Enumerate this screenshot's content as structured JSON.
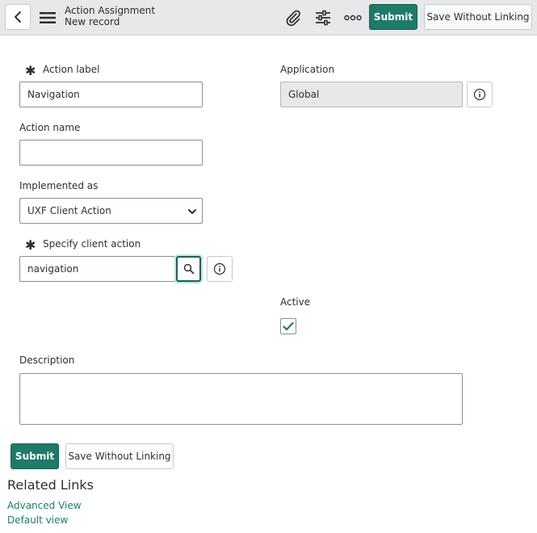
{
  "header": {
    "title": "Action Assignment",
    "subtitle": "New record",
    "submit_label": "Submit",
    "save_without_linking_label": "Save Without Linking"
  },
  "form": {
    "action_label": {
      "label": "Action label",
      "value": "Navigation",
      "required": true
    },
    "application": {
      "label": "Application",
      "value": "Global"
    },
    "action_name": {
      "label": "Action name",
      "value": ""
    },
    "implemented_as": {
      "label": "Implemented as",
      "selected": "UXF Client Action"
    },
    "specify_client_action": {
      "label": "Specify client action",
      "value": "navigation",
      "required": true
    },
    "active": {
      "label": "Active",
      "checked": true
    },
    "description": {
      "label": "Description",
      "value": ""
    }
  },
  "footer": {
    "submit_label": "Submit",
    "save_without_linking_label": "Save Without Linking"
  },
  "related_links": {
    "title": "Related Links",
    "items": [
      "Advanced View",
      "Default view"
    ]
  },
  "colors": {
    "accent": "#1f7a6a",
    "header_bg": "#e6e8ea"
  }
}
